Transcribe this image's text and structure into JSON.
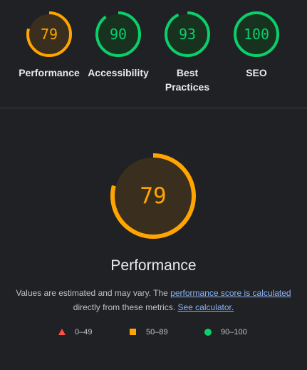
{
  "colors": {
    "fail": "#ff4e42",
    "average": "#ffa400",
    "pass": "#0cce6b",
    "average_fill": "#3a2f1e",
    "pass_fill": "#17331f",
    "background": "#202124"
  },
  "categories": [
    {
      "label": "Performance",
      "score": "79",
      "score_fraction": 0.79,
      "rating": "average"
    },
    {
      "label": "Accessibility",
      "score": "90",
      "score_fraction": 0.9,
      "rating": "pass"
    },
    {
      "label": "Best Practices",
      "score": "93",
      "score_fraction": 0.93,
      "rating": "pass"
    },
    {
      "label": "SEO",
      "score": "100",
      "score_fraction": 1.0,
      "rating": "pass"
    }
  ],
  "main": {
    "score": "79",
    "score_fraction": 0.79,
    "rating": "average",
    "title": "Performance",
    "desc_prefix": "Values are estimated and may vary. The ",
    "desc_link1": "performance score is calculated",
    "desc_middle": " directly from these metrics. ",
    "desc_link2": "See calculator."
  },
  "legend": [
    {
      "range": "0–49",
      "shape": "triangle"
    },
    {
      "range": "50–89",
      "shape": "square"
    },
    {
      "range": "90–100",
      "shape": "circle"
    }
  ]
}
